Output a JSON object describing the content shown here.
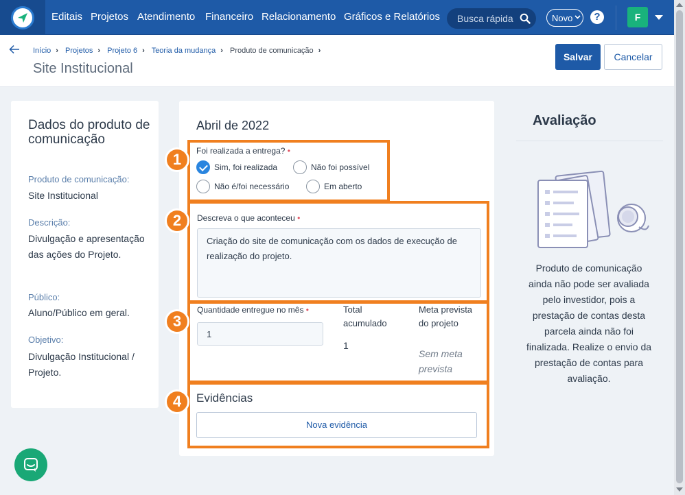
{
  "nav": {
    "items": [
      "Editais",
      "Projetos",
      "Atendimento",
      "Financeiro",
      "Relacionamento",
      "Gráficos e Relatórios"
    ],
    "search_placeholder": "Busca rápida",
    "new_label": "Novo",
    "help_label": "?",
    "avatar_initial": "F"
  },
  "header": {
    "breadcrumbs": [
      "Início",
      "Projetos",
      "Projeto 6",
      "Teoria da mudança",
      "Produto de comunicação"
    ],
    "title": "Site Institucional",
    "save_label": "Salvar",
    "cancel_label": "Cancelar"
  },
  "left": {
    "title": "Dados do produto de comunicação",
    "fields": [
      {
        "label": "Produto de comunicação:",
        "value": "Site Institucional"
      },
      {
        "label": "Descrição:",
        "value": "Divulgação e apresentação das ações do Projeto."
      },
      {
        "label": "Público:",
        "value": "Aluno/Público em geral."
      },
      {
        "label": "Objetivo:",
        "value": "Divulgação Institucional / Projeto."
      }
    ]
  },
  "center": {
    "title": "Abril de 2022",
    "delivery_label": "Foi realizada a entrega?",
    "required_mark": "•",
    "options": [
      {
        "label": "Sim, foi realizada",
        "selected": true
      },
      {
        "label": "Não foi possível",
        "selected": false
      },
      {
        "label": "Não é/foi necessário",
        "selected": false
      },
      {
        "label": "Em aberto",
        "selected": false
      }
    ],
    "describe_label": "Descreva o que aconteceu",
    "describe_value": "Criação do site de comunicação com os dados de execução de realização do projeto.",
    "quantity_label": "Quantidade entregue no mês",
    "quantity_value": "1",
    "total_label": "Total acumulado",
    "total_value": "1",
    "meta_label": "Meta prevista do projeto",
    "meta_value": "Sem meta prevista",
    "evidence_title": "Evidências",
    "evidence_button": "Nova evidência"
  },
  "annotations": [
    "1",
    "2",
    "3",
    "4"
  ],
  "right": {
    "title": "Avaliação",
    "message": "Produto de comunicação ainda não pode ser avaliada pelo investidor, pois a prestação de contas desta parcela ainda não foi finalizada. Realize o envio da prestação de contas para avaliação."
  },
  "colors": {
    "nav_bg": "#1e5aa7",
    "accent": "#1e5aa7",
    "annotation": "#f07f1f",
    "chat": "#19a876",
    "avatar": "#19b27c"
  }
}
